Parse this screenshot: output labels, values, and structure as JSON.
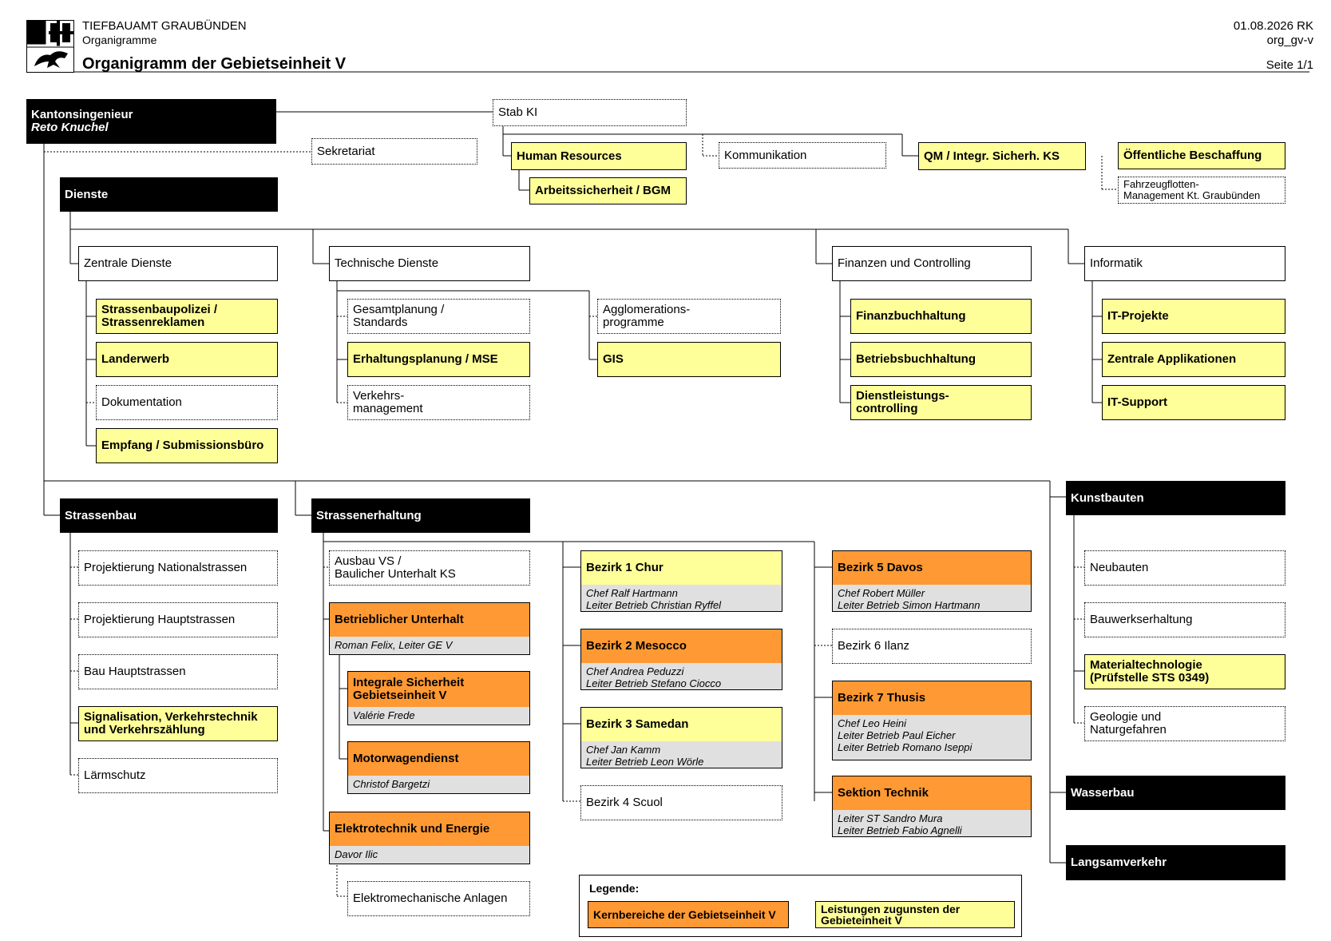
{
  "header": {
    "org_name": "TIEFBAUAMT GRAUBÜNDEN",
    "subtitle": "Organigramme",
    "title": "Organigramm der Gebietseinheit V",
    "date": "01.08.2026 RK",
    "doc_id": "org_gv-v",
    "page": "Seite 1/1"
  },
  "top": {
    "head_title": "Kantonsingenieur",
    "head_name": "Reto Knuchel",
    "stab": "Stab KI",
    "sekretariat": "Sekretariat",
    "human_resources": "Human Resources",
    "arbeitssicherheit": "Arbeitssicherheit / BGM",
    "kommunikation": "Kommunikation",
    "qm": "QM / Integr. Sicherh. KS",
    "beschaffung": "Öffentliche Beschaffung",
    "fahrzeugflotten": "Fahrzeugflotten-\nManagement Kt. Graubünden"
  },
  "dienste": {
    "title": "Dienste",
    "zentrale": {
      "title": "Zentrale Dienste",
      "items": [
        "Strassenbaupolizei /\nStrassenreklamen",
        "Landerwerb",
        "Dokumentation",
        "Empfang / Submissionsbüro"
      ]
    },
    "technische": {
      "title": "Technische Dienste",
      "col1": [
        "Gesamtplanung /\nStandards",
        "Erhaltungsplanung / MSE",
        "Verkehrs-\nmanagement"
      ],
      "col2": [
        "Agglomerations-\nprogramme",
        "GIS"
      ]
    },
    "finanzen": {
      "title": "Finanzen und Controlling",
      "items": [
        "Finanzbuchhaltung",
        "Betriebsbuchhaltung",
        "Dienstleistungs-\ncontrolling"
      ]
    },
    "informatik": {
      "title": "Informatik",
      "items": [
        "IT-Projekte",
        "Zentrale Applikationen",
        "IT-Support"
      ]
    }
  },
  "strassenbau": {
    "title": "Strassenbau",
    "items": [
      "Projektierung Nationalstrassen",
      "Projektierung Hauptstrassen",
      "Bau Hauptstrassen",
      "Signalisation, Verkehrstechnik\nund Verkehrszählung",
      "Lärmschutz"
    ]
  },
  "strassenerhaltung": {
    "title": "Strassenerhaltung",
    "ausbau": "Ausbau VS /\nBaulicher Unterhalt KS",
    "betrieblicher": {
      "title": "Betrieblicher Unterhalt",
      "sub": "Roman Felix, Leiter GE V"
    },
    "integrale": {
      "title": "Integrale Sicherheit\nGebietseinheit V",
      "sub": "Valérie Frede"
    },
    "motorwagen": {
      "title": "Motorwagendienst",
      "sub": "Christof Bargetzi"
    },
    "elektro": {
      "title": "Elektrotechnik und Energie",
      "sub": "Davor Ilic"
    },
    "elektromech": "Elektromechanische Anlagen",
    "bezirk1": {
      "title": "Bezirk 1 Chur",
      "sub": "Chef Ralf Hartmann\nLeiter Betrieb Christian Ryffel"
    },
    "bezirk2": {
      "title": "Bezirk 2 Mesocco",
      "sub": "Chef Andrea Peduzzi\nLeiter Betrieb Stefano Ciocco"
    },
    "bezirk3": {
      "title": "Bezirk 3 Samedan",
      "sub": "Chef Jan Kamm\nLeiter Betrieb Leon Wörle"
    },
    "bezirk4": "Bezirk 4 Scuol",
    "bezirk5": {
      "title": "Bezirk 5 Davos",
      "sub": "Chef Robert Müller\nLeiter Betrieb Simon Hartmann"
    },
    "bezirk6": "Bezirk 6 Ilanz",
    "bezirk7": {
      "title": "Bezirk 7 Thusis",
      "sub": "Chef Leo Heini\nLeiter Betrieb Paul Eicher\nLeiter Betrieb Romano Iseppi"
    },
    "sektion": {
      "title": "Sektion Technik",
      "sub": "Leiter ST Sandro Mura\nLeiter Betrieb Fabio Agnelli"
    }
  },
  "kunstbauten": {
    "title": "Kunstbauten",
    "items": [
      "Neubauten",
      "Bauwerkserhaltung",
      "Materialtechnologie\n(Prüfstelle STS 0349)",
      "Geologie und\nNaturgefahren"
    ]
  },
  "wasserbau": "Wasserbau",
  "langsamverkehr": "Langsamverkehr",
  "legend": {
    "title": "Legende:",
    "core": "Kernbereiche der Gebietseinheit V",
    "service": "Leistungen zugunsten der\nGebieteinheit V"
  },
  "colors": {
    "core": "#ff9933",
    "service": "#ffff99",
    "head": "#000000",
    "sub_bg": "#e0e0e0"
  }
}
